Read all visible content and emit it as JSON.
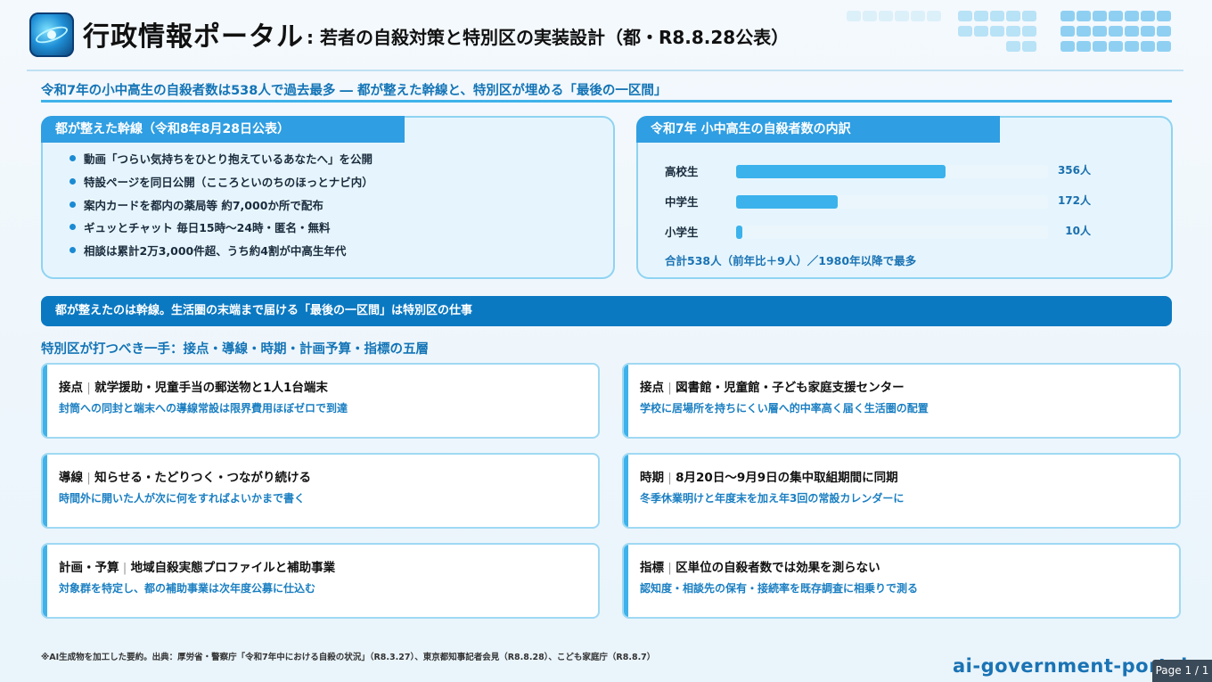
{
  "header": {
    "title_main": "行政情報ポータル",
    "title_sub": ": 若者の自殺対策と特別区の実装設計（都・R8.8.28公表）"
  },
  "headline": "令和7年の小中高生の自殺者数は538人で過去最多 ― 都が整えた幹線と、特別区が埋める「最後の一区間」",
  "left_panel": {
    "tab": "都が整えた幹線（令和8年8月28日公表）",
    "bullets": [
      "動画「つらい気持ちをひとり抱えているあなたへ」を公開",
      "特設ページを同日公開（こころといのちのほっとナビ内）",
      "案内カードを都内の薬局等 約7,000か所で配布",
      "ギュッとチャット 毎日15時〜24時・匿名・無料",
      "相談は累計2万3,000件超、うち約4割が中高生年代"
    ]
  },
  "right_panel": {
    "tab": "令和7年 小中高生の自殺者数の内訳",
    "bars": [
      {
        "label": "高校生",
        "value": 356,
        "value_label": "356人"
      },
      {
        "label": "中学生",
        "value": 172,
        "value_label": "172人"
      },
      {
        "label": "小学生",
        "value": 10,
        "value_label": "10人"
      }
    ],
    "scale_max": 530,
    "bar_color": "#3bb2ec",
    "total": "合計538人（前年比＋9人）／1980年以降で最多"
  },
  "banner": "都が整えたのは幹線。生活圏の末端まで届ける「最後の一区間」は特別区の仕事",
  "section_head": "特別区が打つべき一手：接点・導線・時期・計画予算・指標の五層",
  "cards": [
    {
      "key": "接点",
      "title": "就学援助・児童手当の郵送物と1人1台端末",
      "desc": "封筒への同封と端末への導線常設は限界費用ほぼゼロで到達"
    },
    {
      "key": "接点",
      "title": "図書館・児童館・子ども家庭支援センター",
      "desc": "学校に居場所を持ちにくい層へ的中率高く届く生活圏の配置"
    },
    {
      "key": "導線",
      "title": "知らせる・たどりつく・つながり続ける",
      "desc": "時間外に開いた人が次に何をすればよいかまで書く"
    },
    {
      "key": "時期",
      "title": "8月20日〜9月9日の集中取組期間に同期",
      "desc": "冬季休業明けと年度末を加え年3回の常設カレンダーに"
    },
    {
      "key": "計画・予算",
      "title": "地域自殺実態プロファイルと補助事業",
      "desc": "対象群を特定し、都の補助事業は次年度公募に仕込む"
    },
    {
      "key": "指標",
      "title": "区単位の自殺者数では効果を測らない",
      "desc": "認知度・相談先の保有・接続率を既存調査に相乗りで測る"
    }
  ],
  "footer": "※AI生成物を加工した要約。出典：厚労省・警察庁「令和7年中における自殺の状況」（R8.3.27）、東京都知事記者会見（R8.8.28）、こども家庭庁（R8.8.7）",
  "domain": "ai-government-portal.com",
  "page": "Page 1 / 1",
  "colors": {
    "accent": "#3fb2ea",
    "banner": "#0b79c2",
    "heading": "#1374b6"
  }
}
